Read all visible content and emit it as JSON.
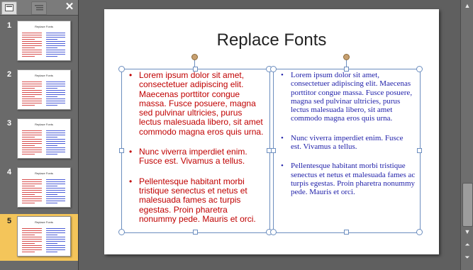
{
  "pane": {
    "close_glyph": "✕",
    "slides": [
      {
        "number": "1",
        "thumb_title": "Replace Fonts"
      },
      {
        "number": "2",
        "thumb_title": "Replace Fonts"
      },
      {
        "number": "3",
        "thumb_title": "Replace Fonts"
      },
      {
        "number": "4",
        "thumb_title": "Replace Fonts"
      },
      {
        "number": "5",
        "thumb_title": "Replace Fonts"
      }
    ],
    "selected_slide": "5"
  },
  "slide": {
    "title": "Replace Fonts",
    "left_bullets": [
      "Lorem ipsum dolor sit amet, consectetuer adipiscing elit. Maecenas porttitor congue massa. Fusce posuere, magna sed pulvinar ultricies, purus lectus malesuada libero, sit amet commodo magna eros quis urna.",
      "Nunc viverra imperdiet enim. Fusce est. Vivamus a tellus.",
      "Pellentesque habitant morbi tristique senectus et netus et malesuada fames ac turpis egestas. Proin pharetra nonummy pede. Mauris et orci."
    ],
    "right_bullets": [
      "Lorem ipsum dolor sit amet, consectetuer adipiscing elit. Maecenas porttitor congue massa. Fusce posuere, magna sed pulvinar ultricies, purus lectus malesuada libero, sit amet commodo magna eros quis urna.",
      "Nunc viverra imperdiet enim. Fusce est. Vivamus a tellus.",
      "Pellentesque habitant morbi tristique senectus et netus et malesuada fames ac turpis egestas. Proin pharetra nonummy pede. Mauris et orci."
    ],
    "left_color": "#c00000",
    "right_color": "#1e1ea8",
    "bullet_glyph": "•"
  },
  "scrollbar": {
    "up_glyph": "▲",
    "down_glyph": "▼",
    "prev_glyph": "⏶",
    "next_glyph": "⏷"
  }
}
